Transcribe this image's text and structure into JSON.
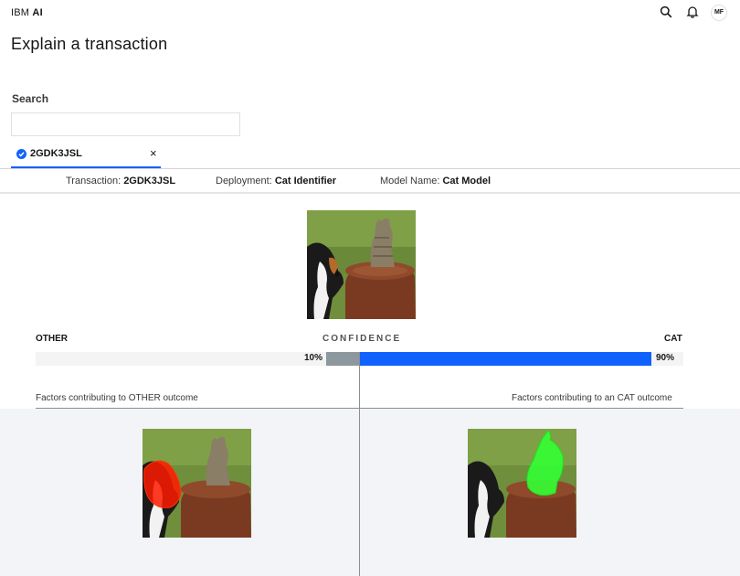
{
  "header": {
    "brand_prefix": "IBM",
    "brand_suffix": "AI",
    "avatar_initials": "MF",
    "icons": [
      "search-icon",
      "notification-icon"
    ]
  },
  "page": {
    "title": "Explain a transaction"
  },
  "search": {
    "label": "Search",
    "value": "",
    "placeholder": ""
  },
  "tab": {
    "label": "2GDK3JSL",
    "close": "×"
  },
  "info": {
    "transaction_label": "Transaction:",
    "transaction_value": "2GDK3JSL",
    "deployment_label": "Deployment:",
    "deployment_value": "Cat Identifier",
    "model_label": "Model Name:",
    "model_value": "Cat Model"
  },
  "confidence": {
    "left_label": "OTHER",
    "center_label": "CONFIDENCE",
    "right_label": "CAT",
    "other_pct_text": "10%",
    "cat_pct_text": "90%",
    "other_value": 0.1,
    "cat_value": 0.9
  },
  "factors": {
    "left_title": "Factors contributing to OTHER outcome",
    "right_title": "Factors contributing to an CAT outcome"
  },
  "colors": {
    "accent": "#0f62fe",
    "other_bar": "#8d979e",
    "other_highlight": "#ff1a00",
    "cat_highlight": "#33ff33",
    "panel_bg": "#f2f4f8"
  }
}
